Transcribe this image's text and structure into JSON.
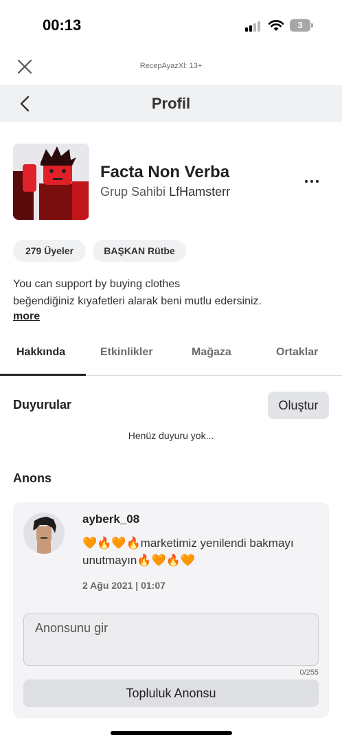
{
  "status_bar": {
    "time": "00:13",
    "battery": "3"
  },
  "header": {
    "site_label": "RecepAyazXl: 13+",
    "title": "Profil"
  },
  "group": {
    "name": "Facta Non Verba",
    "owner_prefix": "Grup Sahibi",
    "owner_name": "LfHamsterr",
    "chips": [
      "279 Üyeler",
      "BAŞKAN Rütbe"
    ],
    "description_line1": "You can support by buying clothes",
    "description_line2": "beğendiğiniz kıyafetleri alarak beni mutlu edersiniz.",
    "more_label": "more"
  },
  "tabs": [
    {
      "label": "Hakkında"
    },
    {
      "label": "Etkinlikler"
    },
    {
      "label": "Mağaza"
    },
    {
      "label": "Ortaklar"
    }
  ],
  "announcements": {
    "title": "Duyurular",
    "create_label": "Oluştur",
    "empty_text": "Henüz duyuru yok..."
  },
  "shout": {
    "title": "Anons",
    "username": "ayberk_08",
    "text": "🧡🔥🧡🔥marketimiz yenilendi bakmayı unutmayın🔥🧡🔥🧡",
    "date": "2 Ağu 2021 | 01:07",
    "input_placeholder": "Anonsunu gir",
    "char_count": "0/255",
    "button_label": "Topluluk Anonsu"
  },
  "colors": {
    "accent_text": "#222222",
    "chip_bg": "#f0f1f3",
    "nav_bg": "#f0f1f3"
  }
}
